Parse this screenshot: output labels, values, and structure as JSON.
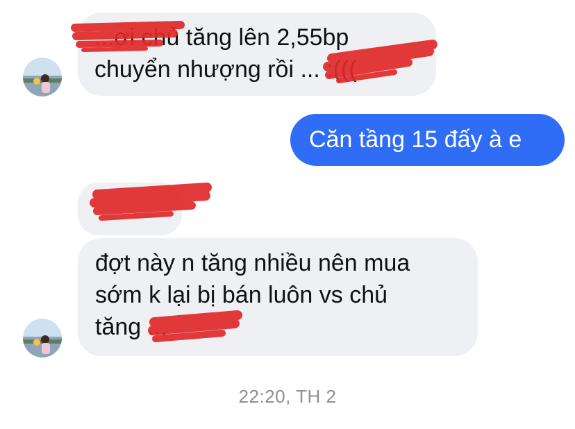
{
  "conversation": {
    "messages": [
      {
        "direction": "incoming",
        "lines": [
          "...ơi chủ tăng lên 2,55bp",
          "chuyển nhượng rồi ... :((("
        ]
      },
      {
        "direction": "outgoing",
        "lines": [
          "Căn tầng 15 đấy à e"
        ]
      },
      {
        "direction": "incoming",
        "lines": [
          "..."
        ]
      },
      {
        "direction": "incoming",
        "lines": [
          "đợt này n tăng nhiều nên mua",
          "sớm k lại bị bán luôn vs chủ",
          "tăng ..."
        ]
      }
    ],
    "timestamp": "22:20, TH 2",
    "redaction_color": "#e02a2a",
    "outgoing_color": "#2f6df6",
    "incoming_color": "#eff0f3",
    "avatar_icon": "contact-avatar-icon"
  }
}
